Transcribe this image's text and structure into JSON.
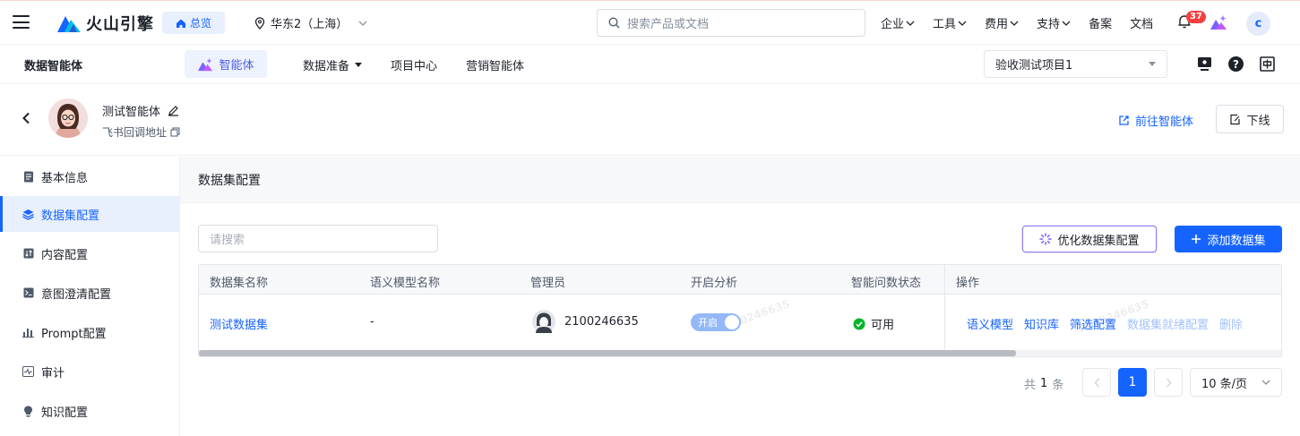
{
  "topbar": {
    "logo_text": "火山引擎",
    "home_label": "总览",
    "region": "华东2（上海）",
    "search_placeholder": "搜索产品或文档",
    "nav": [
      {
        "label": "企业",
        "dropdown": true
      },
      {
        "label": "工具",
        "dropdown": true
      },
      {
        "label": "费用",
        "dropdown": true
      },
      {
        "label": "支持",
        "dropdown": true
      },
      {
        "label": "备案",
        "dropdown": false
      },
      {
        "label": "文档",
        "dropdown": false
      }
    ],
    "notification_count": "37",
    "avatar_letter": "c"
  },
  "subbar": {
    "title": "数据智能体",
    "active_tab": "智能体",
    "nav": [
      "数据准备",
      "项目中心",
      "营销智能体"
    ],
    "project": "验收测试项目1"
  },
  "agent": {
    "name": "测试智能体",
    "feishu_label": "飞书回调地址",
    "goto_label": "前往智能体",
    "offline_label": "下线"
  },
  "sidebar": {
    "items": [
      {
        "label": "基本信息",
        "icon": "doc-icon",
        "active": false
      },
      {
        "label": "数据集配置",
        "icon": "layers-icon",
        "active": true
      },
      {
        "label": "内容配置",
        "icon": "sort-icon",
        "active": false
      },
      {
        "label": "意图澄清配置",
        "icon": "terminal-icon",
        "active": false
      },
      {
        "label": "Prompt配置",
        "icon": "bar-icon",
        "active": false
      },
      {
        "label": "审计",
        "icon": "pulse-icon",
        "active": false
      },
      {
        "label": "知识配置",
        "icon": "bulb-icon",
        "active": false
      }
    ]
  },
  "content": {
    "title": "数据集配置",
    "search_placeholder": "请搜索",
    "optimize_label": "优化数据集配置",
    "add_label": "添加数据集",
    "columns": [
      "数据集名称",
      "语义模型名称",
      "管理员",
      "开启分析",
      "智能问数状态",
      "操作"
    ],
    "rows": [
      {
        "name": "测试数据集",
        "semantic_model": "-",
        "admin": "2100246635",
        "analysis": "开启",
        "status": "可用",
        "actions": [
          "语义模型",
          "知识库",
          "筛选配置",
          "数据集就绪配置",
          "删除"
        ]
      }
    ]
  },
  "pagination": {
    "total_prefix": "共",
    "total_count": "1",
    "total_suffix": "条",
    "current_page": "1",
    "page_size": "10 条/页"
  },
  "watermark": "2100246635",
  "colors": {
    "accent": "#1664ff",
    "success": "#00b42a",
    "danger": "#f53f3f"
  }
}
